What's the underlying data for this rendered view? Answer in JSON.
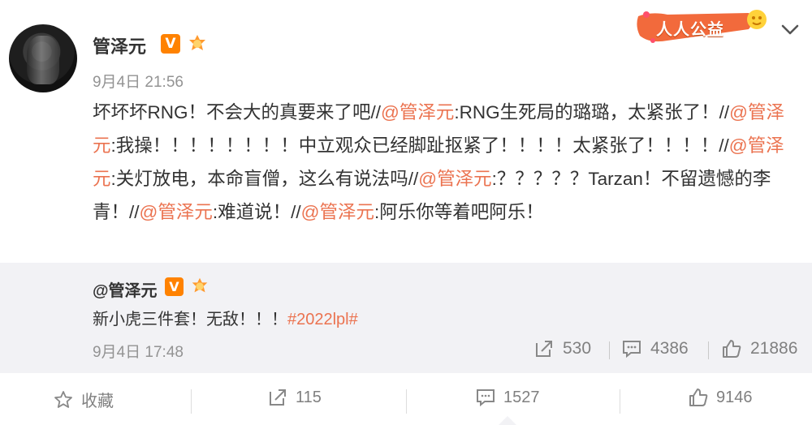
{
  "post": {
    "username": "管泽元",
    "verified_badge": "V",
    "time": "9月4日 21:56",
    "content": {
      "line1_a": "坏坏坏RNG！不会大的真要来了吧//",
      "m1": "@管泽元",
      "line1_b": ":RNG生死局的璐璐，太紧张了！//",
      "m2": "@管泽元",
      "line2": ":我操！！！！！！！！中立观众已经脚趾抠紧了！！！！太紧张了！！！！//",
      "m3": "@管泽元",
      "line3": ":关灯放电，本命盲僧，这么有说法吗//",
      "m4": "@管泽元",
      "line4": ":？？？？？Tarzan！不留遗憾的李青！//",
      "m5": "@管泽元",
      "line5": ":难道说！//",
      "m6": "@管泽元",
      "line6": ":阿乐你等着吧阿乐！"
    }
  },
  "brand": {
    "label": "人人公益"
  },
  "repost": {
    "username": "@管泽元",
    "verified_badge": "V",
    "text": "新小虎三件套！无敌！！！",
    "tag": "#2022lpl#",
    "time": "9月4日 17:48",
    "reposts": "530",
    "comments": "4386",
    "likes": "21886"
  },
  "footer": {
    "favorite_label": "收藏",
    "reposts": "115",
    "comments": "1527",
    "likes": "9146"
  },
  "colors": {
    "accent": "#eb7350",
    "badge": "#ff8200",
    "muted": "#939393",
    "repost_bg": "#f2f2f5"
  }
}
